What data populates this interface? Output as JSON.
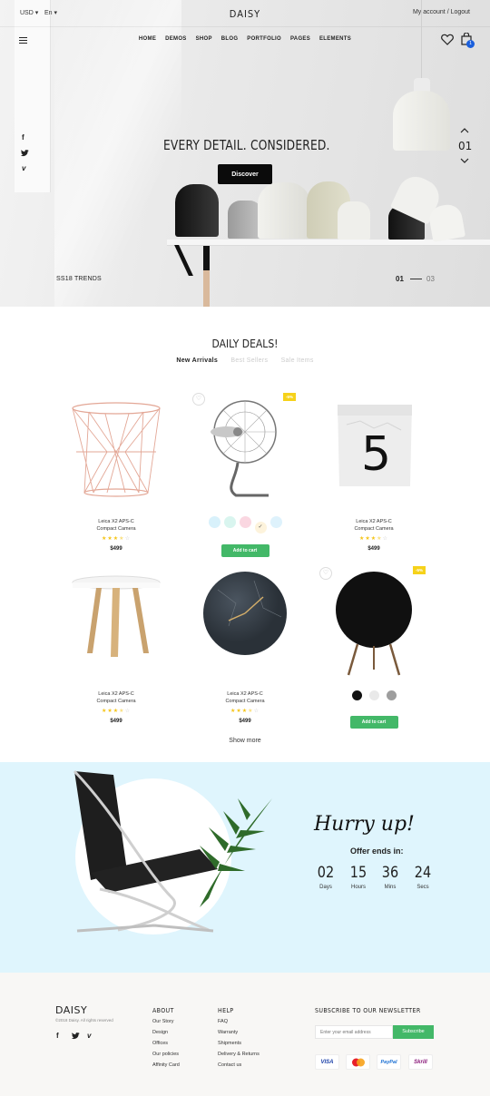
{
  "topbar": {
    "currency": "USD",
    "language": "En",
    "logo": "DAISY",
    "account_label": "My account / Logout",
    "cart_count": "1"
  },
  "nav": {
    "items": [
      "HOME",
      "DEMOS",
      "SHOP",
      "BLOG",
      "PORTFOLIO",
      "PAGES",
      "ELEMENTS"
    ]
  },
  "hero": {
    "headline": "EVERY DETAIL. CONSIDERED.",
    "cta": "Discover",
    "slide_number": "01",
    "trends_label": "SS18 TRENDS",
    "pager_current": "01",
    "pager_total": "03"
  },
  "deals": {
    "title": "DAILY DEALS!",
    "tabs": [
      "New Arrivals",
      "Best Sellers",
      "Sale Items"
    ],
    "active_tab": "New Arrivals",
    "products": [
      {
        "name_line1": "Leica X2 APS-C",
        "name_line2": "Compact Camera",
        "rating": 3.5,
        "price": "$499"
      },
      {
        "badge": "-5%",
        "swatches": [
          "#d8f1fb",
          "#d9f5ef",
          "#fad7e1",
          "#fdf3dc",
          "#def2fc"
        ],
        "checkmark": "✓",
        "button": "Add to cart"
      },
      {
        "name_line1": "Leica X2 APS-C",
        "name_line2": "Compact Camera",
        "rating": 3.5,
        "price": "$499"
      },
      {
        "name_line1": "Leica X2 APS-C",
        "name_line2": "Compact Camera",
        "rating": 3.5,
        "price": "$499"
      },
      {
        "name_line1": "Leica X2 APS-C",
        "name_line2": "Compact Camera",
        "rating": 3.5,
        "price": "$499"
      },
      {
        "badge": "-5%",
        "swatches": [
          "#111111",
          "#e9e9e9",
          "#9e9e9e"
        ],
        "button": "Add to cart"
      }
    ],
    "show_more": "Show more"
  },
  "hurry": {
    "script_title": "Hurry up!",
    "subtitle": "Offer ends in:",
    "countdown": [
      {
        "value": "02",
        "label": "Days"
      },
      {
        "value": "15",
        "label": "Hours"
      },
      {
        "value": "36",
        "label": "Mins"
      },
      {
        "value": "24",
        "label": "Secs"
      }
    ]
  },
  "footer": {
    "logo": "DAISY",
    "copyright": "©2018 Daisy. All rights reserved",
    "about_title": "ABOUT",
    "about_links": [
      "Our Story",
      "Design",
      "Offices",
      "Our policies",
      "Affinity Card"
    ],
    "help_title": "HELP",
    "help_links": [
      "FAQ",
      "Warranty",
      "Shipments",
      "Delivery & Returns",
      "Contact us"
    ],
    "newsletter_title": "SUBSCRIBE TO OUR NEWSLETTER",
    "email_placeholder": "Enter your email address",
    "subscribe_label": "Subscribe",
    "payments": [
      "VISA",
      "mastercard",
      "PayPal",
      "Skrill"
    ]
  },
  "colors": {
    "accent_green": "#43b868",
    "badge_yellow": "#f6d21a",
    "cart_badge": "#1a5fdc",
    "hurry_bg": "#dff5fd"
  }
}
